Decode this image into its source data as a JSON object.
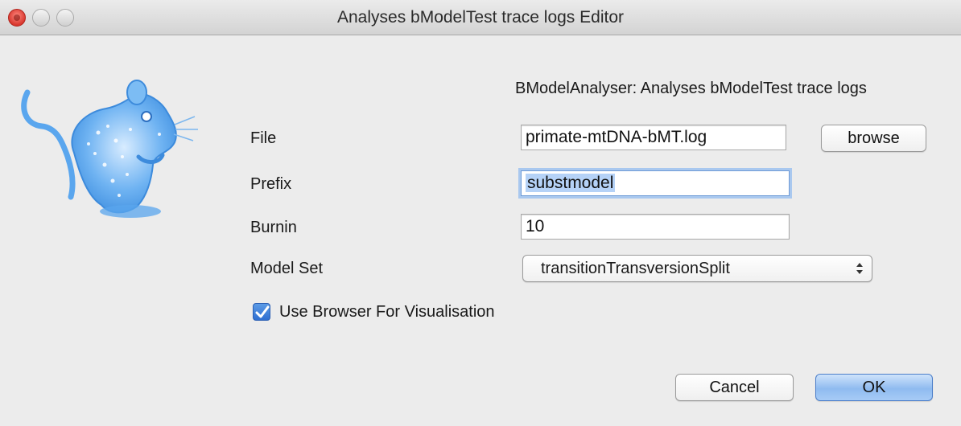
{
  "window": {
    "title": "Analyses bModelTest trace logs Editor"
  },
  "header": {
    "description": "BModelAnalyser: Analyses bModelTest trace logs"
  },
  "form": {
    "file": {
      "label": "File",
      "value": "primate-mtDNA-bMT.log",
      "browse_label": "browse"
    },
    "prefix": {
      "label": "Prefix",
      "value": "substmodel"
    },
    "burnin": {
      "label": "Burnin",
      "value": "10"
    },
    "model_set": {
      "label": "Model Set",
      "selected": "transitionTransversionSplit"
    },
    "use_browser": {
      "label": "Use Browser For Visualisation",
      "checked": true
    }
  },
  "buttons": {
    "cancel": "Cancel",
    "ok": "OK"
  },
  "colors": {
    "accent": "#3a7de0",
    "mascot": "#5aa6ee"
  },
  "icons": {
    "mascot": "beast-mouse-logo",
    "checkmark": "checkmark-icon",
    "select_arrows": "updown-arrows-icon"
  }
}
